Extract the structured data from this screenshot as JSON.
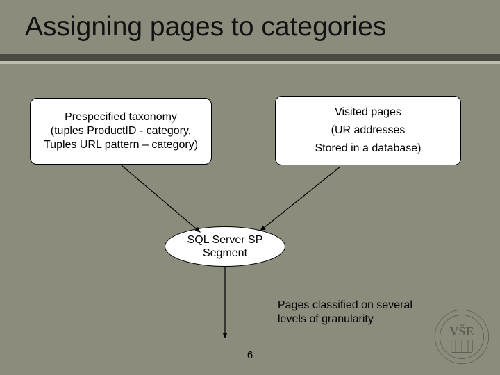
{
  "title": "Assigning pages to categories",
  "nodes": {
    "left_box": {
      "line1": "Prespecified taxonomy",
      "line2": "(tuples ProductID  - category,",
      "line3": "Tuples URL pattern – category)"
    },
    "right_box": {
      "line1": "Visited pages",
      "line2": "(UR addresses",
      "line3": "Stored in a database)"
    },
    "sql_ellipse": {
      "line1": "SQL Server SP",
      "line2": "Segment"
    }
  },
  "output_text": {
    "line1": "Pages classified on several",
    "line2": "levels of granularity"
  },
  "page_number": "6",
  "logo_alt": "VŠE"
}
